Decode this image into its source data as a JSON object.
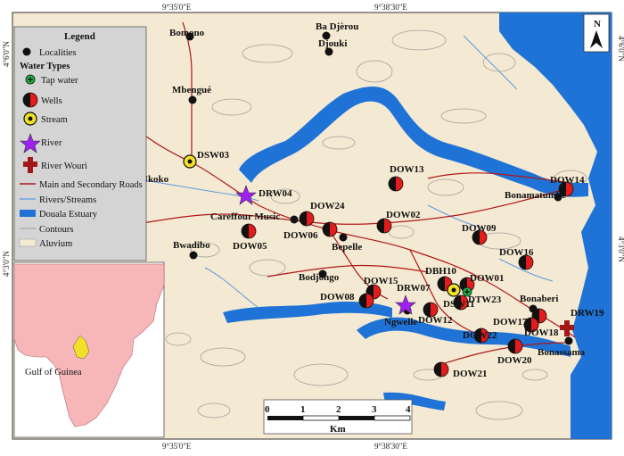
{
  "map": {
    "coords": {
      "top_left": "9°35'0\"E",
      "top_right": "9°38'30\"E",
      "bottom_left": "9°35'0\"E",
      "bottom_right": "9°38'30\"E",
      "left_top": "4°6'0\"N",
      "left_bottom": "4°3'0\"N",
      "right_top": "4°6'0\"N",
      "right_bottom": "4°3'0\"N"
    },
    "north_label": "N",
    "localities": [
      "Bomono",
      "Ba Djèrou",
      "Djouki",
      "Mbengué",
      "Nkoko",
      "Careffour Music",
      "Bepelle",
      "Bonamatumbe",
      "Bwadibo",
      "Bodjongo",
      "Ngwelle",
      "Bonaberi",
      "Bonassama"
    ],
    "wells": [
      "DOW13",
      "DOW14",
      "DOW24",
      "DOW06",
      "DOW02",
      "DOW05",
      "DOW09",
      "DOW16",
      "DOW15",
      "DOW08",
      "DBH10",
      "DOW01",
      "DTW23",
      "DOW12",
      "DOW17",
      "DOW22",
      "DOW18",
      "DOW20",
      "DOW21"
    ],
    "streams": [
      "DSW03",
      "DSW11"
    ],
    "rivers": [
      "DRW04",
      "DRW07"
    ],
    "river_wouri": [
      "DRW19"
    ],
    "tap_water": []
  },
  "legend": {
    "title": "Legend",
    "localities": "Localities",
    "water_types": "Water Types",
    "tap": "Tap water",
    "wells": "Wells",
    "stream": "Stream",
    "river": "River",
    "wouri": "River Wouri",
    "roads": "Main and Secondary Roads",
    "rivers_streams": "Rivers/Streams",
    "estuary": "Douala Estuary",
    "contours": "Contours",
    "alluvium": "Aluvium"
  },
  "inset": {
    "gulf_label": "Gulf of Guinea"
  },
  "scalebar": {
    "ticks": [
      "0",
      "1",
      "2",
      "3",
      "4"
    ],
    "unit": "Km"
  },
  "colors": {
    "land": "#f4e9d2",
    "water": "#1f73d6",
    "roads": "#b01818",
    "legend_bg": "#d4d4d4",
    "africa": "#f7b7b9",
    "sea_inset": "#ffffff",
    "cameroon": "#f3e128"
  }
}
